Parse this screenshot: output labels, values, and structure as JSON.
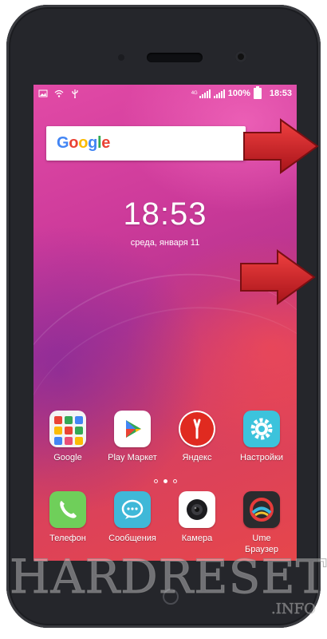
{
  "status_bar": {
    "network": "4G",
    "battery": "100%",
    "time": "18:53"
  },
  "search": {
    "logo": "Google"
  },
  "lock_clock": {
    "time": "18:53",
    "date": "среда, января 11"
  },
  "apps_row1": [
    {
      "label": "Google",
      "icon": "google-folder-icon"
    },
    {
      "label": "Play Маркет",
      "icon": "play-store-icon"
    },
    {
      "label": "Яндекс",
      "icon": "yandex-icon"
    },
    {
      "label": "Настройки",
      "icon": "settings-icon"
    }
  ],
  "page_indicator": {
    "pages": 3,
    "current": 2
  },
  "apps_row2": [
    {
      "label": "Телефон",
      "icon": "phone-icon"
    },
    {
      "label": "Сообщения",
      "icon": "messages-icon"
    },
    {
      "label": "Камера",
      "icon": "camera-icon"
    },
    {
      "label": "Ume\nБраузер",
      "icon": "ume-browser-icon"
    }
  ],
  "watermark": {
    "main": "HARDRESET",
    "suffix": ".INFO"
  },
  "colors": {
    "arrow": "#d9252a",
    "accent": "#e24aa6"
  }
}
